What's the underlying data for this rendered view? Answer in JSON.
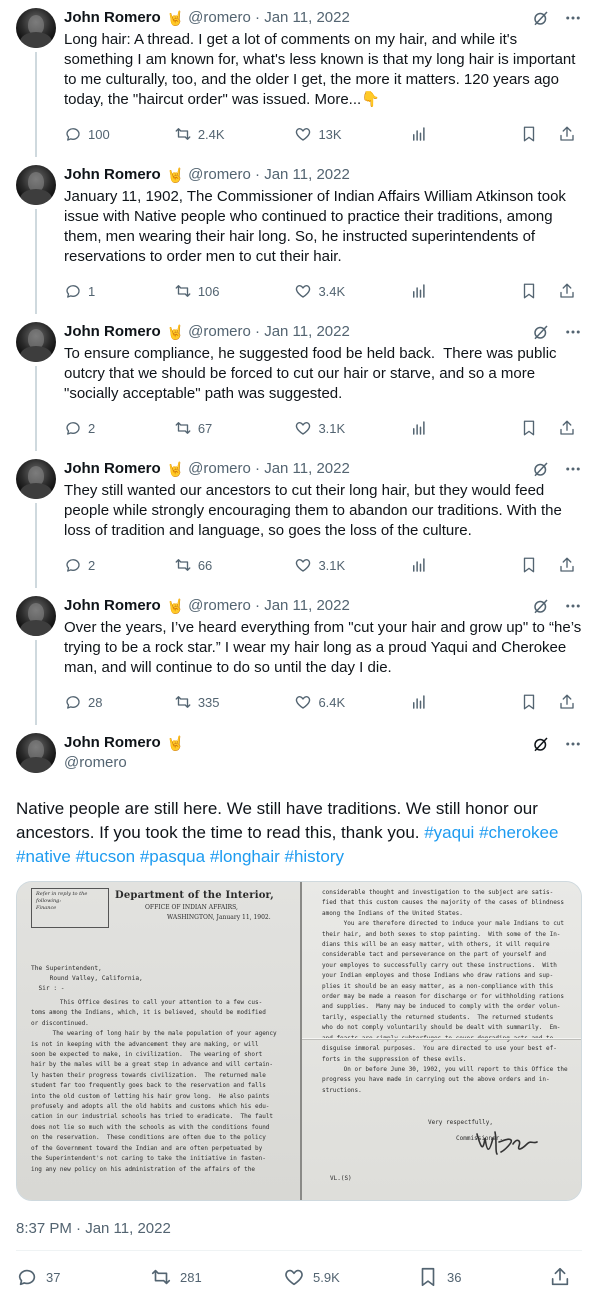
{
  "thread": [
    {
      "name": "John Romero",
      "emoji": "🤘",
      "handle_date": "@romero · Jan 11, 2022",
      "text": "Long hair: A thread. I get a lot of comments on my hair, and while it's something I am known for, what's less known is that my long hair is important to me culturally, too, and the older I get, the more it matters. 120 years ago today, the \"haircut order\" was issued. More...",
      "more_emoji": "👇",
      "replies": "100",
      "retweets": "2.4K",
      "likes": "13K"
    },
    {
      "name": "John Romero",
      "emoji": "🤘",
      "handle_date": "@romero · Jan 11, 2022",
      "text": "January 11, 1902, The Commissioner of Indian Affairs William Atkinson took issue with Native people who continued to practice their traditions, among them, men wearing their hair long. So, he instructed superintendents of reservations to order men to cut their hair.",
      "replies": "1",
      "retweets": "106",
      "likes": "3.4K"
    },
    {
      "name": "John Romero",
      "emoji": "🤘",
      "handle_date": "@romero · Jan 11, 2022",
      "text": "To ensure compliance, he suggested food be held back.  There was public outcry that we should be forced to cut our hair or starve, and so a more \"socially acceptable\" path was suggested.",
      "replies": "2",
      "retweets": "67",
      "likes": "3.1K"
    },
    {
      "name": "John Romero",
      "emoji": "🤘",
      "handle_date": "@romero · Jan 11, 2022",
      "text": "They still wanted our ancestors to cut their long hair, but they would feed people while strongly encouraging them to abandon our traditions. With the loss of tradition and language, so goes the loss of the culture.",
      "replies": "2",
      "retweets": "66",
      "likes": "3.1K"
    },
    {
      "name": "John Romero",
      "emoji": "🤘",
      "handle_date": "@romero · Jan 11, 2022",
      "text": "Over the years, I’ve heard everything from \"cut your hair and grow up\" to “he’s trying to be a rock star.” I wear my hair long as a proud Yaqui and Cherokee man, and will continue to do so until the day I die.",
      "replies": "28",
      "retweets": "335",
      "likes": "6.4K"
    }
  ],
  "main": {
    "name": "John Romero",
    "emoji": "🤘",
    "handle": "@romero",
    "text": "Native people are still here. We still have traditions. We still honor our ancestors. If you took the time to read this, thank you. ",
    "hashtags": [
      "#yaqui",
      "#cherokee",
      "#native",
      "#tucson",
      "#pasqua",
      "#longhair",
      "#history"
    ],
    "timestamp": "8:37 PM · Jan 11, 2022",
    "replies": "37",
    "retweets": "281",
    "likes": "5.9K",
    "bookmarks": "36"
  },
  "document": {
    "stamp": "Refer in reply to the following:\nFinance",
    "dept": "Department of the Interior,",
    "office": "OFFICE OF INDIAN AFFAIRS,",
    "dateline": "WASHINGTON,   January 11, 1902.",
    "address": "The Superintendent,\n     Round Valley, California,\n  Sir : -",
    "left_body": "        This Office desires to call your attention to a few cus-\ntoms among the Indians, which, it is believed, should be modified\nor discontinued.\n      The wearing of long hair by the male population of your agency\nis not in keeping with the advancement they are making, or will\nsoon be expected to make, in civilization.  The wearing of short\nhair by the males will be a great step in advance and will certain-\nly hasten their progress towards civilization.  The returned male\nstudent far too frequently goes back to the reservation and falls\ninto the old custom of letting his hair grow long.  He also paints\nprofusely and adopts all the old habits and customs which his edu-\ncation in our industrial schools has tried to eradicate.  The fault\ndoes not lie so much with the schools as with the conditions found\non the reservation.  These conditions are often due to the policy\nof the Government toward the Indian and are often perpetuated by\nthe Superintendent's not caring to take the initiative in fasten-\ning any new policy on his administration of the affairs of the",
    "right_body": "considerable thought and investigation to the subject are satis-\nfied that this custom causes the majority of the cases of blindness\namong the Indians of the United States.\n      You are therefore directed to induce your male Indians to cut\ntheir hair, and both sexes to stop painting.  With some of the In-\ndians this will be an easy matter, with others, it will require\nconsiderable tact and perseverance on the part of yourself and\nyour employes to successfully carry out these instructions.  With\nyour Indian employes and those Indians who draw rations and sup-\nplies it should be an easy matter, as a non-compliance with this\norder may be made a reason for discharge or for withholding rations\nand supplies.  Many may be induced to comply with the order volun-\ntarily, especially the returned students.  The returned students\nwho do not comply voluntarily should be dealt with summarily.  Em-\nand feasts are simply subterfuges to cover degrading acts and to\ndisguise immoral purposes.  You are directed to use your best ef-\nforts in the suppression of these evils.\n      On or before June 30, 1902, you will report to this Office the\nprogress you have made in carrying out the above orders and in-\nstructions.",
    "respectfully": "Very respectfully,",
    "commissioner": "Commissioner.",
    "vl": "VL.(S)"
  }
}
